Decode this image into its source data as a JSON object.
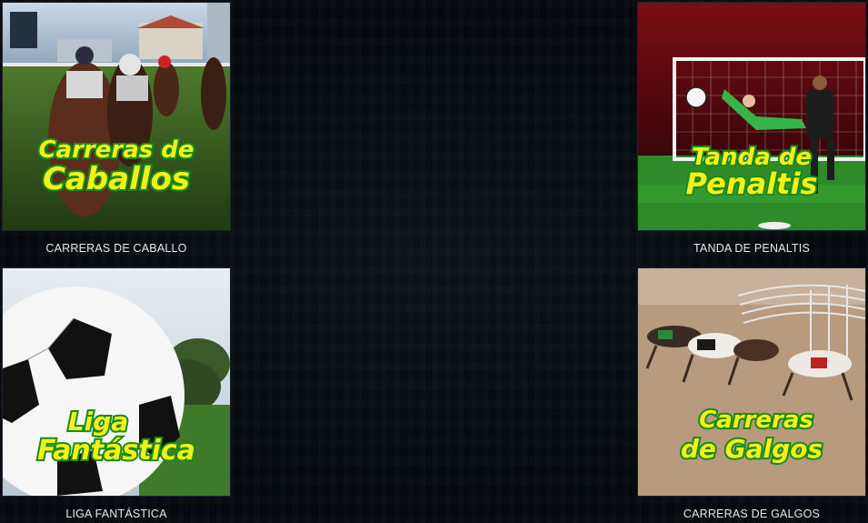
{
  "games": [
    {
      "id": "horses",
      "title_line1": "Carreras de",
      "title_line2": "Caballos",
      "caption": "CARRERAS DE CABALLO"
    },
    {
      "id": "penalties",
      "title_line1": "Tanda de",
      "title_line2": "Penaltis",
      "caption": "TANDA DE PENALTIS"
    },
    {
      "id": "fantasy",
      "title_line1": "Liga",
      "title_line2": "Fantástica",
      "caption": "LIGA FANTÁSTICA"
    },
    {
      "id": "greyhounds",
      "title_line1": "Carreras",
      "title_line2": "de Galgos",
      "caption": "CARRERAS DE GALGOS"
    }
  ],
  "colors": {
    "title_fill": "#f4f01a",
    "title_outline": "#1a8a1a",
    "background": "#05090d",
    "caption": "#e8e8e8"
  }
}
